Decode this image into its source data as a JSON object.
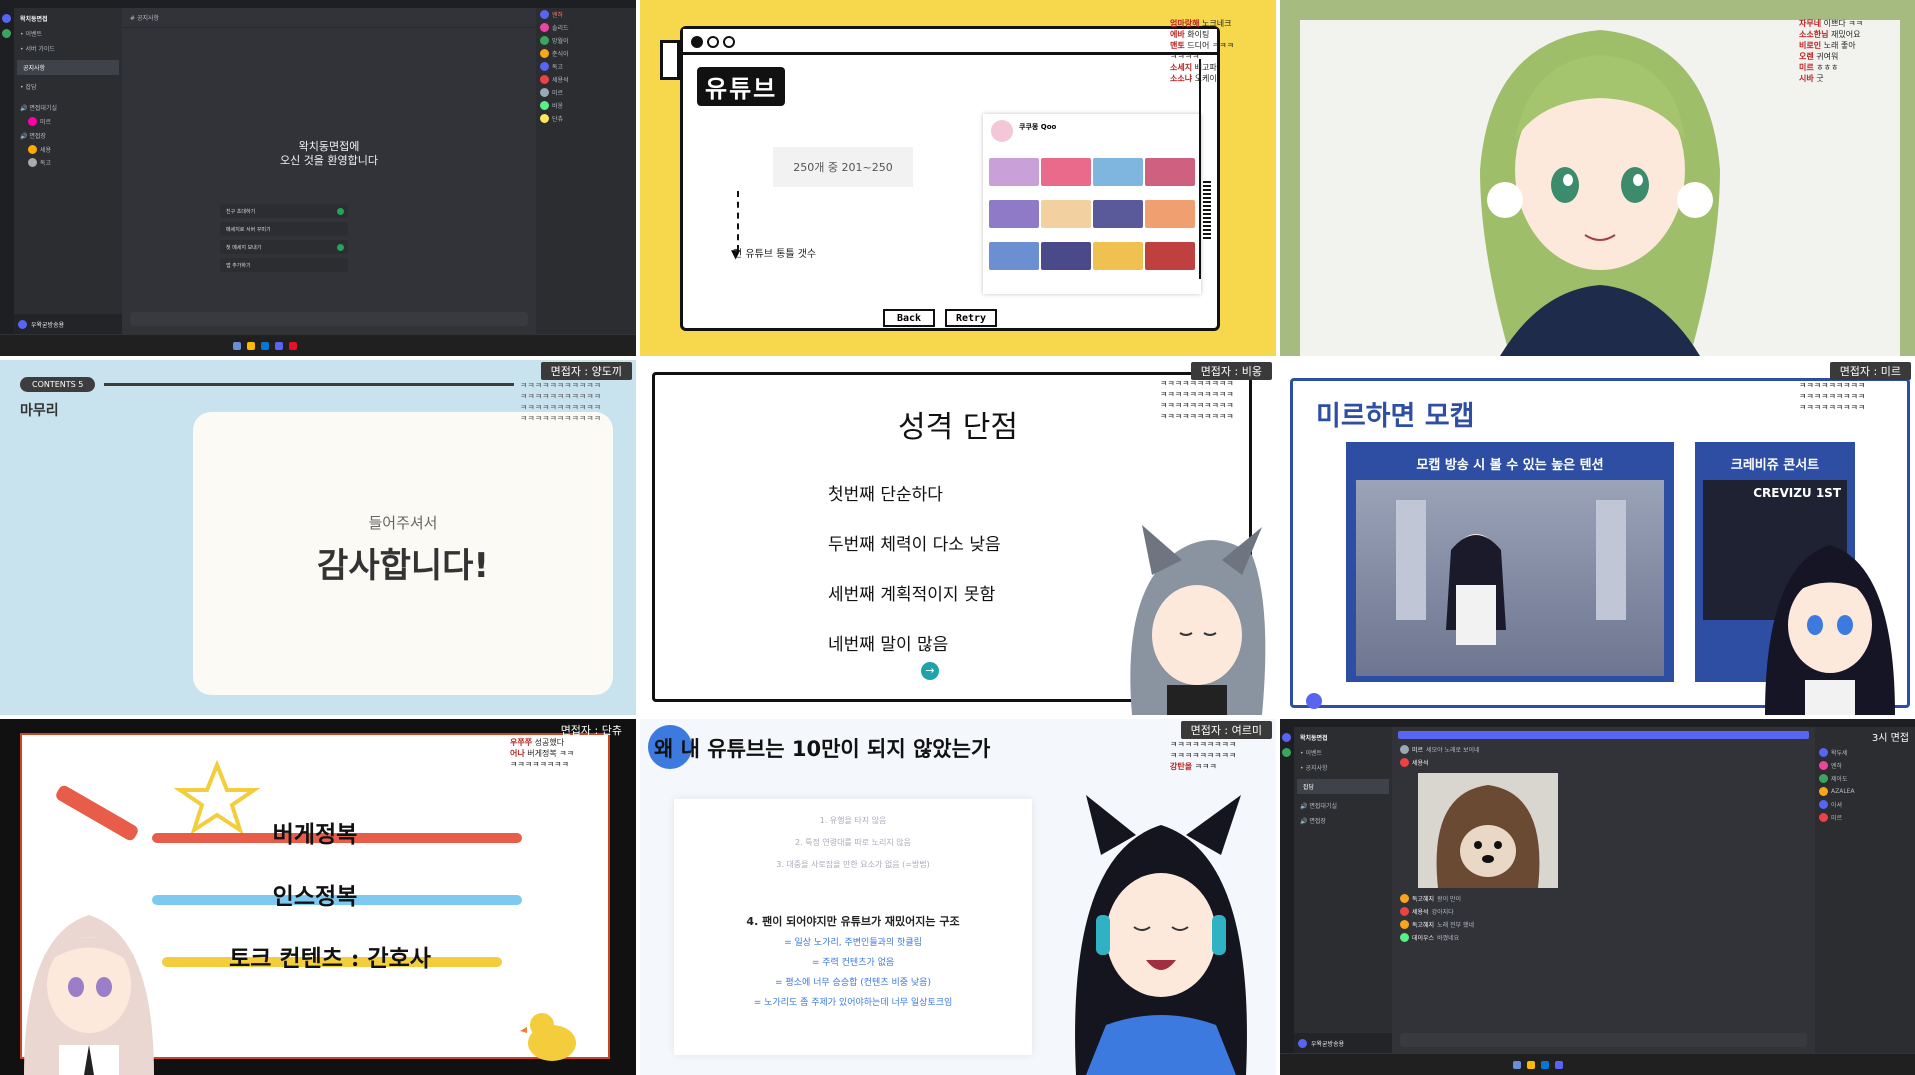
{
  "cells": {
    "discord_welcome": {
      "server_name": "왁치동면접",
      "channel_name": "공지사항",
      "welcome_title_1": "왁치동면접에",
      "welcome_title_2": "오신 것을 환영합니다",
      "tasks": [
        "친구 초대하기",
        "메세지로 서버 꾸미기",
        "첫 메세지 보내기",
        "앱 추가하기"
      ],
      "user_name": "우왁굳방송용"
    },
    "youtube_retro": {
      "logo": "유튜브",
      "count_label": "250개 중 201~250",
      "caption": "전 유튜브 통틀 갯수",
      "channel_name": "쿠쿠몽 Qoo",
      "back_label": "Back",
      "retry_label": "Retry",
      "chat": [
        {
          "name": "엄마랑해",
          "msg": "노크네크"
        },
        {
          "name": "에바",
          "msg": "화이팅"
        },
        {
          "name": "맨토",
          "msg": "드디어 ㅋㅋㅋ"
        },
        {
          "name": "",
          "msg": "ㅋㅋㅋㅋ"
        },
        {
          "name": "소세지",
          "msg": "배고파"
        },
        {
          "name": "소소냐",
          "msg": "오케이"
        }
      ]
    },
    "vtuber_green": {
      "chat": [
        {
          "name": "자무네",
          "msg": "이쁘다 ㅋㅋ"
        },
        {
          "name": "소소한님",
          "msg": "재밌어요"
        },
        {
          "name": "비로인",
          "msg": "노래 좋아"
        },
        {
          "name": "오렌",
          "msg": "귀여워"
        },
        {
          "name": "미르",
          "msg": "ㅎㅎㅎ"
        },
        {
          "name": "시바",
          "msg": "굿"
        }
      ]
    },
    "thanks_slide": {
      "interviewer": "면접자 : 양도끼",
      "contents_badge": "CONTENTS 5",
      "section": "마무리",
      "small_text": "들어주셔서",
      "big_text": "감사합니다!"
    },
    "personality_slide": {
      "interviewer": "면접자 : 비옹",
      "title": "성격 단점",
      "items": [
        "첫번째 단순하다",
        "두번째 체력이 다소 낮음",
        "세번째 계획적이지 못함",
        "네번째 말이 많음"
      ]
    },
    "mocap_slide": {
      "interviewer": "면접자 : 미르",
      "title": "미르하면 모캡",
      "card1_title": "모캡 방송 시 볼 수 있는 높은 텐션",
      "card2_title": "크레비쥬 콘서트",
      "card2_sub": "CREVIZU 1ST"
    },
    "skills_slide": {
      "interviewer": "면접자 : 단츄",
      "lines": [
        "버게정복",
        "인스정복",
        "토크 컨텐츠 : 간호사"
      ]
    },
    "youtube_100k_slide": {
      "interviewer": "면접자 : 여르미",
      "title": "왜 내 유튜브는 10만이 되지 않았는가",
      "faded": [
        "1. 유행을 타지 않음",
        "2. 특정 연령대를 따로 노리지 않음",
        "3. 대중을 사로잡을 만한 요소가 없음 (=방법)"
      ],
      "heading": "4. 팬이 되어야지만 유튜브가 재밌어지는 구조",
      "points": [
        "= 일상 노가리, 주변인들과의 핫클립",
        "= 주력 컨텐츠가 없음",
        "= 평소에 너무 승승합 (컨텐츠 비중 낮음)",
        "= 노가리도 좀 주제가 있어야하는데 너무 일상토크임"
      ]
    },
    "discord_dog": {
      "interviewer": "3시 면접",
      "server_name": "왁치동면접",
      "channel_name": "잡담",
      "messages": [
        {
          "name": "미르",
          "msg": "세모야 노래로 보이네"
        },
        {
          "name": "세용석",
          "msg": "귀엽다 ㅋㅋ"
        },
        {
          "name": "독고혜지",
          "msg": "왕이 만이"
        },
        {
          "name": "세용석",
          "msg": "강아지다"
        },
        {
          "name": "독고혜지",
          "msg": "노래 전부 했네"
        },
        {
          "name": "데이우스",
          "msg": "바꼈네요"
        }
      ],
      "user_name": "우왁굳방송용"
    }
  },
  "colors": {
    "discord_bg": "#313338",
    "retro_yellow": "#f7d84c",
    "soft_blue": "#c8e2ee",
    "mocap_blue": "#2e4ea3",
    "slide_red": "#e85c4a",
    "slide_blue": "#7ec9ef",
    "slide_yellow": "#f3cd3b"
  }
}
